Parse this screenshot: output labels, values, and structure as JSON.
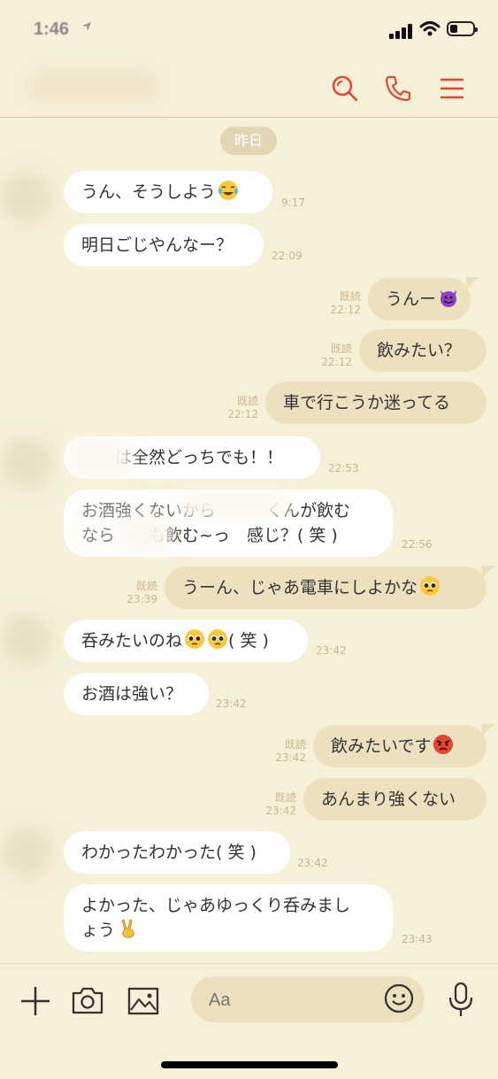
{
  "status": {
    "time": "1:46",
    "location_icon": "location-arrow-icon"
  },
  "header": {
    "icons": [
      "search-icon",
      "phone-icon",
      "menu-icon"
    ],
    "accent": "#e0453a"
  },
  "date_label": "昨日",
  "messages": [
    {
      "side": "left",
      "text": "うん、そうしよう",
      "emoji": "laughing-tears-emoji",
      "time": "9:17"
    },
    {
      "side": "left",
      "text": "明日ごじやんなー？",
      "time": "22:09"
    },
    {
      "side": "right",
      "text": "うんー",
      "emoji": "devil-emoji",
      "read": "既読",
      "time": "22:12"
    },
    {
      "side": "right",
      "text": "飲みたい？",
      "read": "既読",
      "time": "22:12"
    },
    {
      "side": "right",
      "text": "車で行こうか迷ってる",
      "read": "既読",
      "time": "22:12"
    },
    {
      "side": "left",
      "text": "は全然どっちでも！！",
      "time": "22:53"
    },
    {
      "side": "left",
      "text_line1": "お酒強くないから　　　くんが飲む",
      "text_line2": "なら　　も飲む~っ　感じ？( 笑 )",
      "time": "22:56"
    },
    {
      "side": "right",
      "text": "うーん、じゃあ電車にしよかな",
      "emoji": "pleading-emoji",
      "read": "既読",
      "time": "23:39"
    },
    {
      "side": "left",
      "text": "呑みたいのね",
      "suffix": "( 笑 )",
      "time": "23:42"
    },
    {
      "side": "left",
      "text": "お酒は強い？",
      "time": "23:42"
    },
    {
      "side": "right",
      "text": "飲みたいです",
      "emoji": "angry-face-emoji",
      "read": "既読",
      "time": "23:42"
    },
    {
      "side": "right",
      "text": "あんまり強くない",
      "read": "既読",
      "time": "23:42"
    },
    {
      "side": "left",
      "text": "わかったわかった( 笑 )",
      "time": "23:42"
    },
    {
      "side": "left",
      "text_line1": "よかった、じゃあゆっくり呑みまし",
      "text_line2": "ょう",
      "emoji": "victory-hand-emoji",
      "time": "23:43"
    }
  ],
  "input": {
    "placeholder": "Aa"
  },
  "toolbar_icons": [
    "plus-icon",
    "camera-icon",
    "image-icon",
    "smiley-icon",
    "microphone-icon"
  ]
}
